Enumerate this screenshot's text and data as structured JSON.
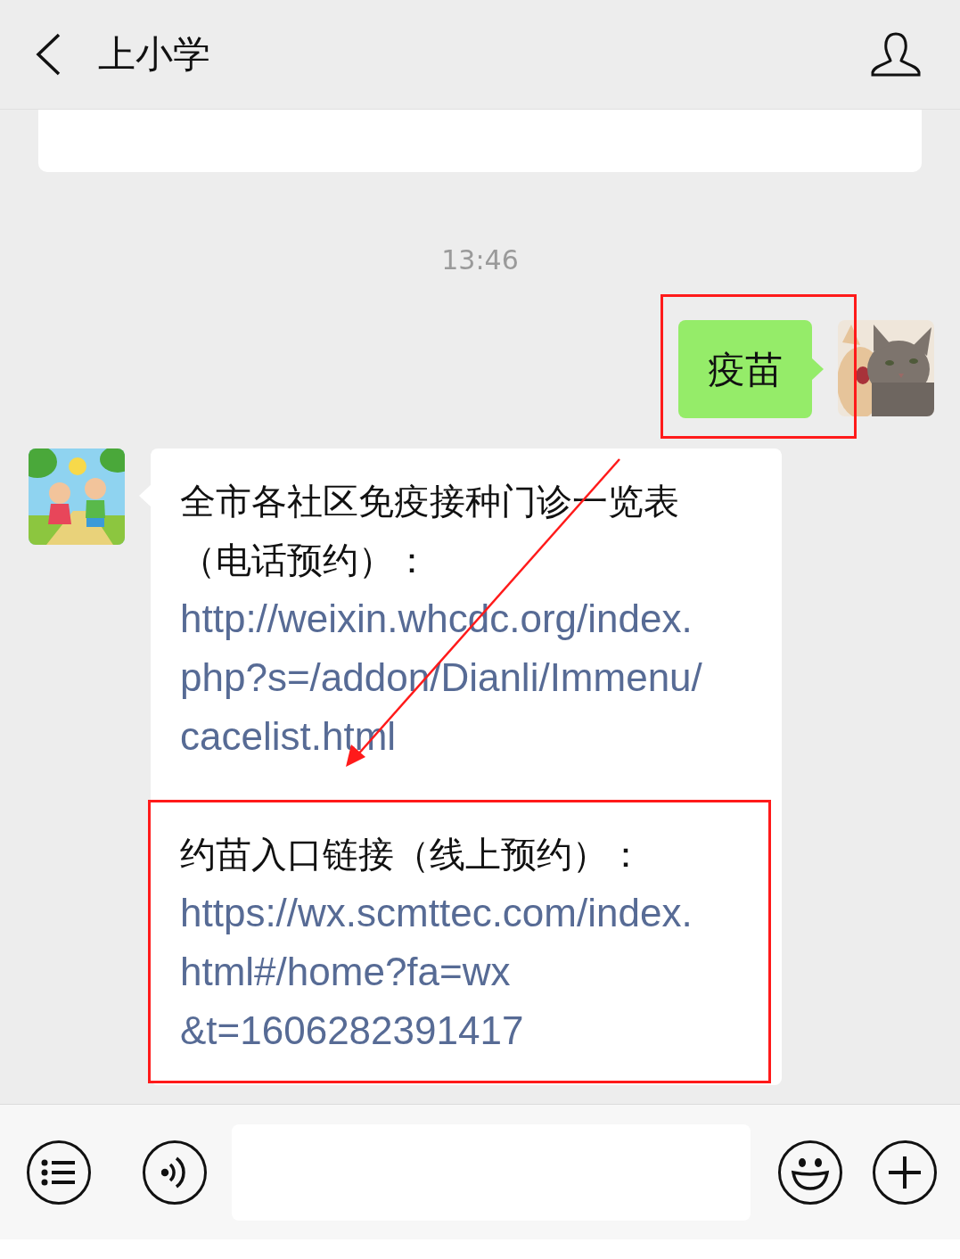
{
  "header": {
    "title": "上小学"
  },
  "timestamp": "13:46",
  "sent_message": {
    "text": "疫苗",
    "highlighted": true
  },
  "received_message": {
    "paragraphs": [
      {
        "text_lines": [
          "全市各社区免疫接种门诊一览表",
          "（电话预约）："
        ],
        "link_lines": [
          "http://weixin.whcdc.org/index.",
          "php?s=/addon/Dianli/Immenu/",
          "cacelist.html"
        ],
        "highlighted": false
      },
      {
        "text_lines": [
          "约苗入口链接（线上预约）："
        ],
        "link_lines": [
          "https://wx.scmttec.com/index.",
          "html#/home?fa=wx",
          "&t=1606282391417"
        ],
        "highlighted": true
      }
    ]
  },
  "annotation_arrow": true
}
